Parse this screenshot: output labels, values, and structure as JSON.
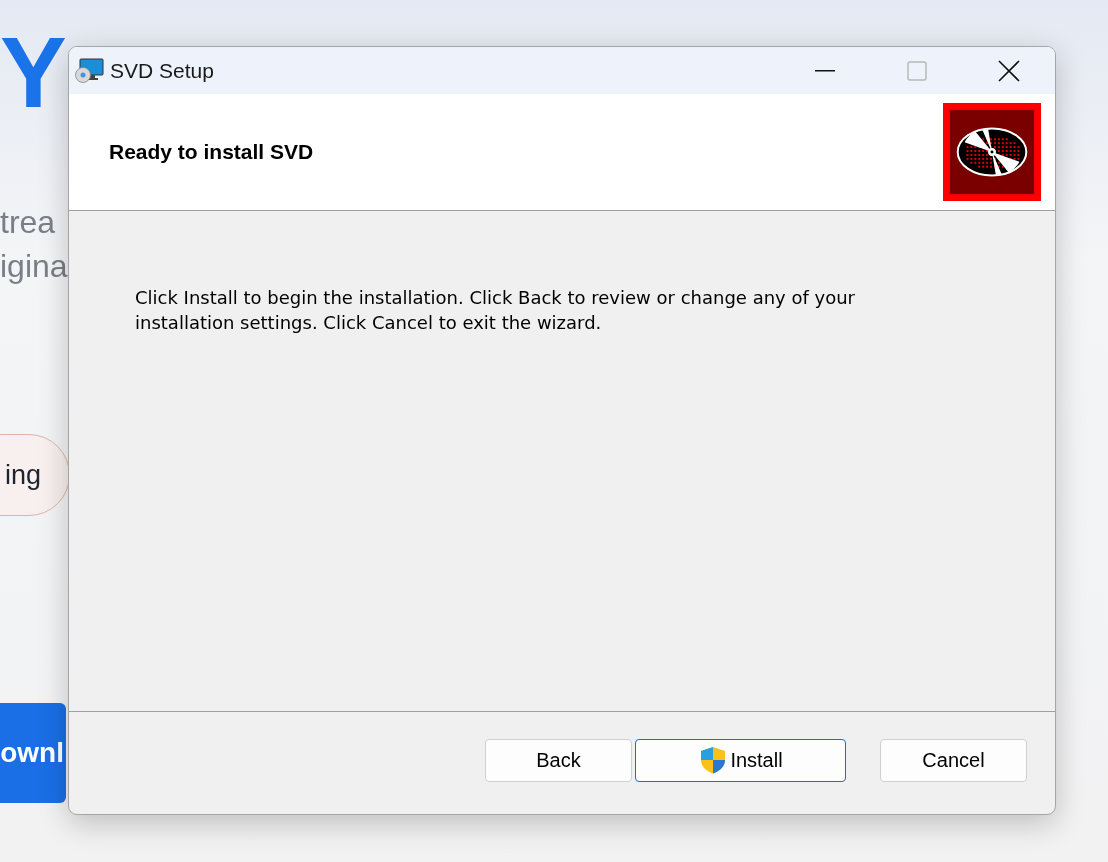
{
  "background_page": {
    "heading": "Y",
    "text_lines": [
      "trea",
      "igina"
    ],
    "pill_button": "ing",
    "download_button": "ownl"
  },
  "window": {
    "title": "SVD Setup"
  },
  "header": {
    "title": "Ready to install SVD"
  },
  "body": {
    "message": "Click Install to begin the installation. Click Back to review or change any of your installation settings. Click Cancel to exit the wizard."
  },
  "buttons": [
    {
      "label": "Back",
      "kind": "plain",
      "default": false
    },
    {
      "label": "Install",
      "kind": "shield",
      "default": true
    },
    {
      "label": "Cancel",
      "kind": "plain",
      "default": false
    }
  ]
}
